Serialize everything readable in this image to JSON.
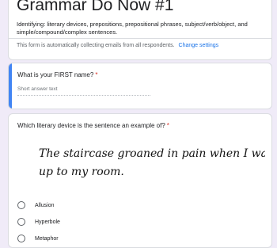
{
  "form": {
    "title": "Grammar Do Now #1",
    "description": "Identifying: literary devices, prepositions, prepositional phrases, subject/verb/object, and simple/compound/complex sentences.",
    "email_notice": "This form is automatically collecting emails from all respondents.",
    "change_settings": "Change settings"
  },
  "questions": {
    "name": {
      "label": "What is your FIRST name?",
      "required_mark": "*",
      "placeholder": "Short answer text"
    },
    "device": {
      "label": "Which literary device is the sentence an example of?",
      "required_mark": "*",
      "sentence_line1": "The staircase groaned in pain when I walked",
      "sentence_line2": "up to my room.",
      "options": [
        "Allusion",
        "Hyperbole",
        "Metaphor"
      ]
    }
  },
  "colors": {
    "background": "#f0ebf8",
    "accent": "#4285f4",
    "required": "#d93025",
    "link": "#1a73e8"
  }
}
